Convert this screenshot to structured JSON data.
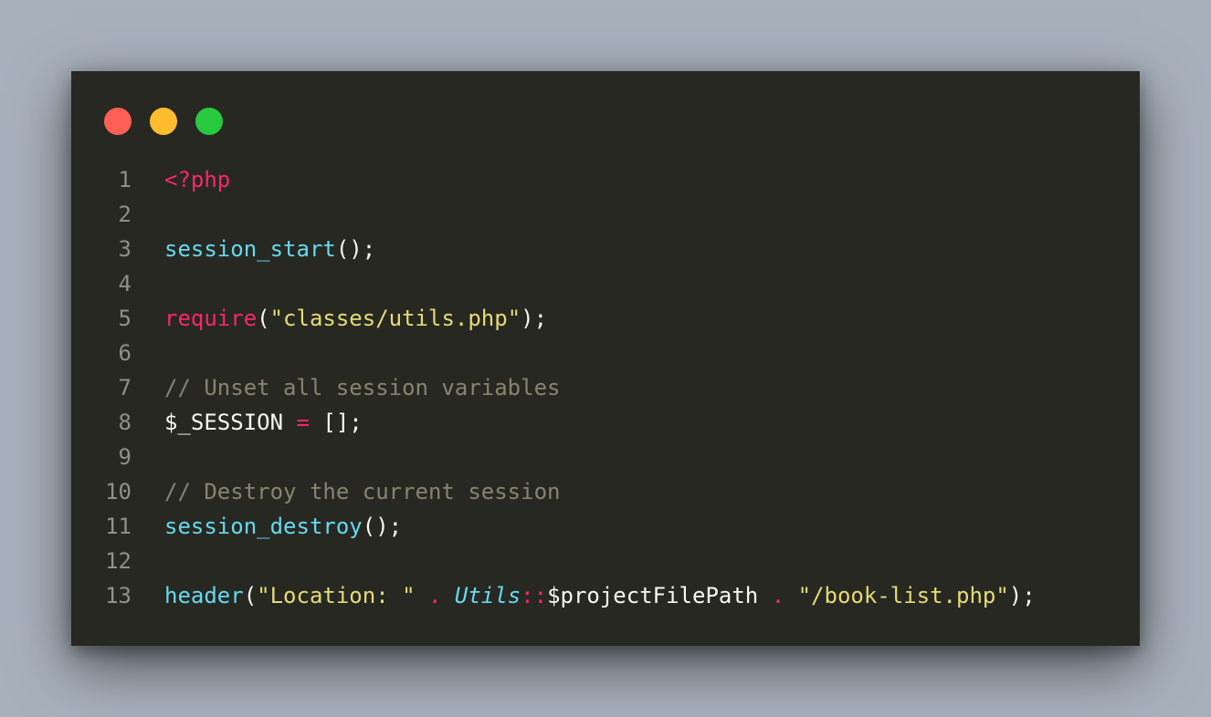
{
  "window": {
    "controls": [
      {
        "name": "close",
        "color": "#ff5f56"
      },
      {
        "name": "minimize",
        "color": "#ffbd2e"
      },
      {
        "name": "maximize",
        "color": "#27c93f"
      }
    ]
  },
  "code": {
    "lines": [
      {
        "n": "1",
        "tokens": [
          {
            "t": "<?php",
            "c": "tag"
          }
        ]
      },
      {
        "n": "2",
        "tokens": []
      },
      {
        "n": "3",
        "tokens": [
          {
            "t": "session_start",
            "c": "fn"
          },
          {
            "t": "();",
            "c": "pl"
          }
        ]
      },
      {
        "n": "4",
        "tokens": []
      },
      {
        "n": "5",
        "tokens": [
          {
            "t": "require",
            "c": "kw"
          },
          {
            "t": "(",
            "c": "pl"
          },
          {
            "t": "\"classes/utils.php\"",
            "c": "str"
          },
          {
            "t": ");",
            "c": "pl"
          }
        ]
      },
      {
        "n": "6",
        "tokens": []
      },
      {
        "n": "7",
        "tokens": [
          {
            "t": "// Unset all session variables",
            "c": "cm"
          }
        ]
      },
      {
        "n": "8",
        "tokens": [
          {
            "t": "$_SESSION ",
            "c": "pl"
          },
          {
            "t": "=",
            "c": "op"
          },
          {
            "t": " [];",
            "c": "pl"
          }
        ]
      },
      {
        "n": "9",
        "tokens": []
      },
      {
        "n": "10",
        "tokens": [
          {
            "t": "// Destroy the current session",
            "c": "cm"
          }
        ]
      },
      {
        "n": "11",
        "tokens": [
          {
            "t": "session_destroy",
            "c": "fn"
          },
          {
            "t": "();",
            "c": "pl"
          }
        ]
      },
      {
        "n": "12",
        "tokens": []
      },
      {
        "n": "13",
        "tokens": [
          {
            "t": "header",
            "c": "fn"
          },
          {
            "t": "(",
            "c": "pl"
          },
          {
            "t": "\"Location: \"",
            "c": "str"
          },
          {
            "t": " ",
            "c": "pl"
          },
          {
            "t": ".",
            "c": "op"
          },
          {
            "t": " ",
            "c": "pl"
          },
          {
            "t": "Utils",
            "c": "cls"
          },
          {
            "t": "::",
            "c": "op"
          },
          {
            "t": "$projectFilePath ",
            "c": "pl"
          },
          {
            "t": ".",
            "c": "op"
          },
          {
            "t": " ",
            "c": "pl"
          },
          {
            "t": "\"/book-list.php\"",
            "c": "str"
          },
          {
            "t": ");",
            "c": "pl"
          }
        ]
      }
    ]
  }
}
